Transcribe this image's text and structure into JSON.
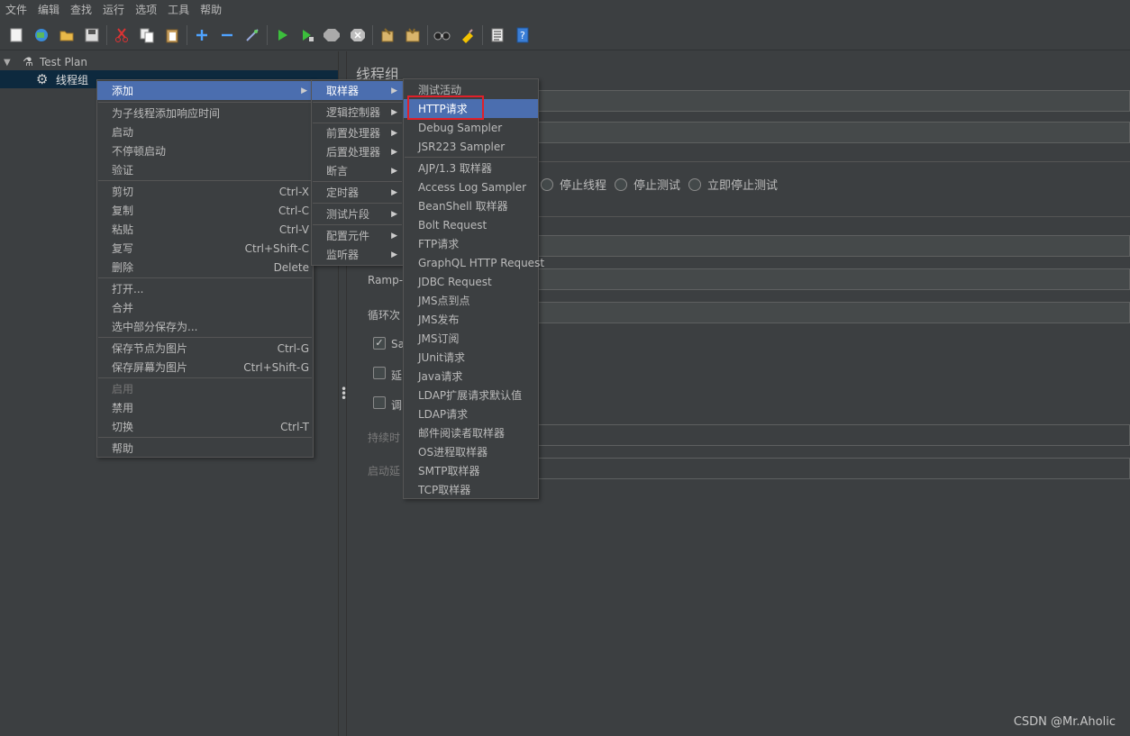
{
  "menubar": {
    "items": [
      "文件",
      "编辑",
      "查找",
      "运行",
      "选项",
      "工具",
      "帮助"
    ]
  },
  "toolbar": {
    "icons": [
      "new-icon",
      "templates-icon",
      "open-icon",
      "save-icon",
      "cut-icon",
      "copy-icon",
      "paste-icon",
      "expand-icon",
      "collapse-icon",
      "toggle-icon",
      "start-icon",
      "start-no-pause-icon",
      "stop-icon",
      "shutdown-icon",
      "clear-icon",
      "clear-all-icon",
      "search-icon",
      "reset-search-icon",
      "function-helper-icon",
      "help-icon"
    ]
  },
  "tree": {
    "root_label": "Test Plan",
    "child_label": "线程组"
  },
  "panel": {
    "title": "线程组",
    "radio_stop_thread": "停止线程",
    "radio_stop_test": "停止测试",
    "radio_stop_now": "立即停止测试",
    "ramp_label": "Ramp-U",
    "loop_label": "循环次",
    "cb1_label": "Sa",
    "cb2_label": "延",
    "cb3_label": "调",
    "duration_label": "持续时",
    "startup_label": "启动延"
  },
  "context_menu": {
    "items": [
      {
        "label": "添加",
        "shortcut": ""
      },
      {
        "label": "为子线程添加响应时间",
        "shortcut": ""
      },
      {
        "label": "启动",
        "shortcut": ""
      },
      {
        "label": "不停顿启动",
        "shortcut": ""
      },
      {
        "label": "验证",
        "shortcut": ""
      },
      {
        "label": "剪切",
        "shortcut": "Ctrl-X"
      },
      {
        "label": "复制",
        "shortcut": "Ctrl-C"
      },
      {
        "label": "粘贴",
        "shortcut": "Ctrl-V"
      },
      {
        "label": "复写",
        "shortcut": "Ctrl+Shift-C"
      },
      {
        "label": "删除",
        "shortcut": "Delete"
      },
      {
        "label": "打开...",
        "shortcut": ""
      },
      {
        "label": "合并",
        "shortcut": ""
      },
      {
        "label": "选中部分保存为...",
        "shortcut": ""
      },
      {
        "label": "保存节点为图片",
        "shortcut": "Ctrl-G"
      },
      {
        "label": "保存屏幕为图片",
        "shortcut": "Ctrl+Shift-G"
      },
      {
        "label": "启用",
        "shortcut": ""
      },
      {
        "label": "禁用",
        "shortcut": ""
      },
      {
        "label": "切换",
        "shortcut": "Ctrl-T"
      },
      {
        "label": "帮助",
        "shortcut": ""
      }
    ]
  },
  "add_submenu": {
    "items": [
      "取样器",
      "逻辑控制器",
      "前置处理器",
      "后置处理器",
      "断言",
      "定时器",
      "测试片段",
      "配置元件",
      "监听器"
    ]
  },
  "sampler_submenu": {
    "items": [
      "测试活动",
      "HTTP请求",
      "Debug Sampler",
      "JSR223 Sampler",
      "AJP/1.3 取样器",
      "Access Log Sampler",
      "BeanShell 取样器",
      "Bolt Request",
      "FTP请求",
      "GraphQL HTTP Request",
      "JDBC Request",
      "JMS点到点",
      "JMS发布",
      "JMS订阅",
      "JUnit请求",
      "Java请求",
      "LDAP扩展请求默认值",
      "LDAP请求",
      "邮件阅读者取样器",
      "OS进程取样器",
      "SMTP取样器",
      "TCP取样器"
    ]
  },
  "watermark": "CSDN @Mr.Aholic",
  "colors": {
    "background": "#3c3f41",
    "highlight": "#4b6eaf",
    "selected_tree_row": "#0d293e",
    "red_box": "#e0202a"
  }
}
